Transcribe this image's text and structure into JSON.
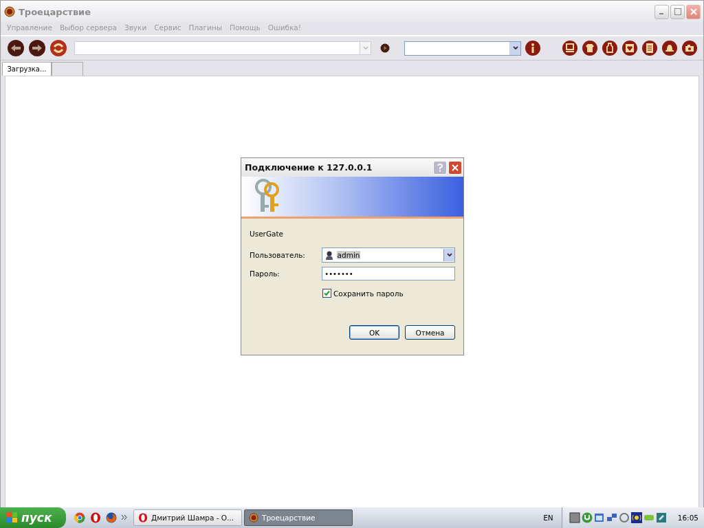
{
  "window": {
    "title": "Троецарствие"
  },
  "menu": [
    "Управление",
    "Выбор сервера",
    "Звуки",
    "Сервис",
    "Плагины",
    "Помощь",
    "Ошибка!"
  ],
  "tabs": [
    {
      "label": "Загрузка...",
      "selected": true
    },
    {
      "selected": false
    }
  ],
  "dialog": {
    "title": "Подключение к 127.0.0.1",
    "server": "UserGate",
    "user_label": "Пользователь:",
    "user_value": "admin",
    "password_label": "Пароль:",
    "password_value": "•••••••",
    "remember": {
      "label": "Сохранить пароль",
      "checked": true
    },
    "buttons": [
      "OK",
      "Отмена"
    ]
  },
  "taskbar": {
    "start": "пуск",
    "windows": [
      {
        "label": "Дмитрий Шамра - О...",
        "kind": "opera",
        "selected": false
      },
      {
        "label": "Троецарствие",
        "kind": "app",
        "selected": true
      }
    ],
    "language": "EN",
    "clock": "16:05"
  }
}
